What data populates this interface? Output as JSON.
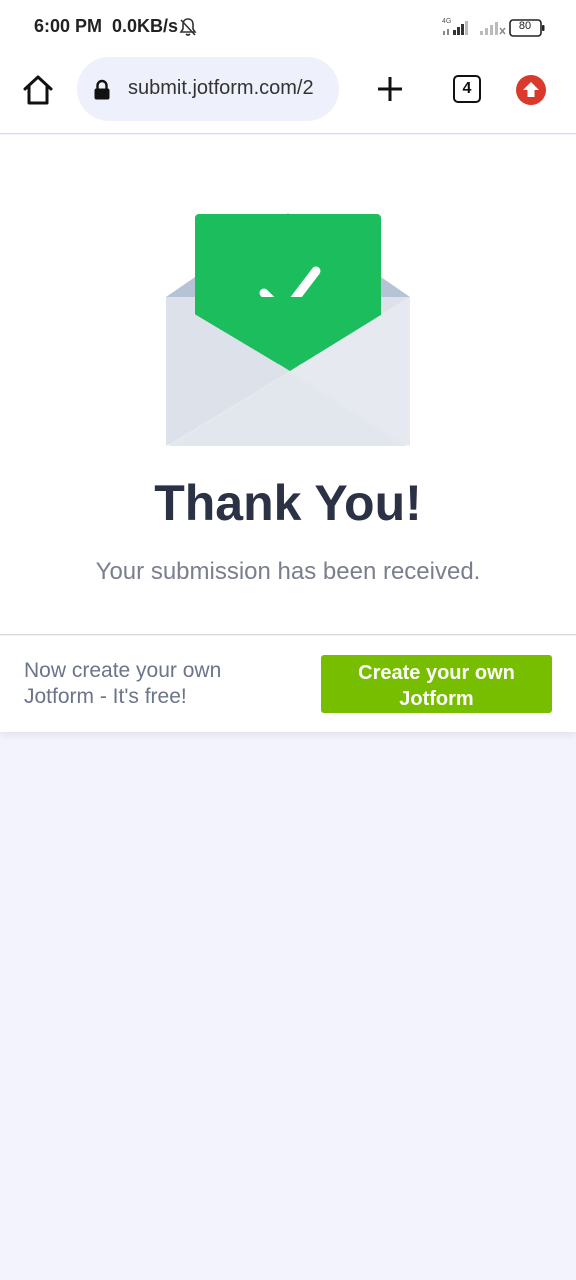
{
  "status_bar": {
    "time": "6:00 PM",
    "speed": "0.0KB/s",
    "network_label": "4G",
    "battery": "80",
    "icons": [
      "bell-off-icon",
      "signal-icon",
      "battery-icon"
    ]
  },
  "browser": {
    "url": "submit.jotform.com/2",
    "tab_count": "4",
    "icons": [
      "home-icon",
      "lock-icon",
      "plus-icon",
      "tabs-icon",
      "update-icon"
    ]
  },
  "thank_you": {
    "title": "Thank You!",
    "subtitle": "Your submission has been received.",
    "icon": "envelope-check-icon"
  },
  "promo": {
    "text": "Now create your own Jotform - It's free!",
    "button_label": "Create your own Jotform"
  },
  "colors": {
    "accent_green": "#1bbd5d",
    "button_green": "#78be00",
    "title_color": "#2b3245",
    "page_background": "#f3f3fd"
  }
}
